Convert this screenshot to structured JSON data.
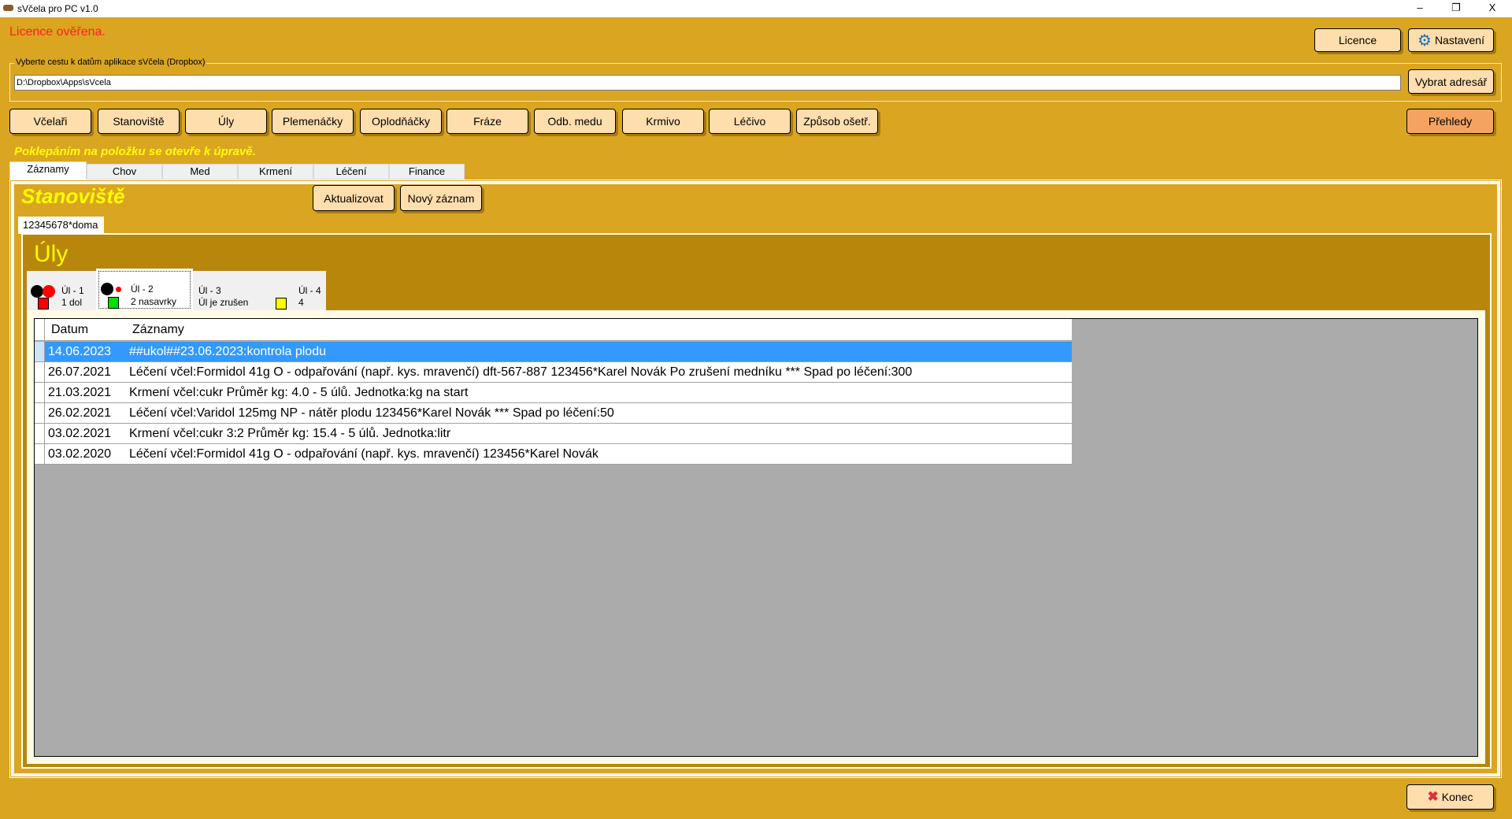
{
  "window": {
    "title": "sVčela pro PC v1.0",
    "minimize": "–",
    "restore": "❐",
    "close": "X"
  },
  "license_status": "Licence ověřena.",
  "top_buttons": {
    "licence": "Licence",
    "settings": "Nastavení"
  },
  "path": {
    "legend": "Vyberte cestu k datům aplikace sVčela (Dropbox)",
    "value": "D:\\Dropbox\\Apps\\sVcela",
    "browse": "Vybrat adresář"
  },
  "nav": [
    "Včelaři",
    "Stanoviště",
    "Úly",
    "Plemenáčky",
    "Oplodňáčky",
    "Fráze",
    "Odb. medu",
    "Krmivo",
    "Léčivo",
    "Způsob ošetř."
  ],
  "overview": "Přehledy",
  "hint": "Poklepáním na položku se otevře k úpravě.",
  "tabs": [
    "Záznamy",
    "Chov",
    "Med",
    "Krmení",
    "Léčení",
    "Finance"
  ],
  "section": {
    "title": "Stanoviště",
    "refresh": "Aktualizovat",
    "new": "Nový záznam",
    "site_tab": "12345678*doma",
    "hives_title": "Úly"
  },
  "hives": [
    {
      "name": "Úl - 1",
      "info": "1 dol",
      "square": "#ff0000"
    },
    {
      "name": "Úl - 2",
      "info": "2 nasavrky",
      "square": "#00e000"
    },
    {
      "name": "Úl - 3",
      "info": "Úl je zrušen"
    },
    {
      "name": "Úl - 4",
      "info": "4",
      "square": "#ffff00"
    }
  ],
  "grid": {
    "headers": [
      "Datum",
      "Záznamy"
    ],
    "rows": [
      {
        "date": "14.06.2023",
        "text": "##ukol##23.06.2023:kontrola plodu"
      },
      {
        "date": "26.07.2021",
        "text": "Léčení včel:Formidol 41g O - odpařování (např. kys. mravenčí) dft-567-887 123456*Karel Novák Po zrušení medníku *** Spad po léčení:300"
      },
      {
        "date": "21.03.2021",
        "text": "Krmení včel:cukr Průměr kg: 4.0 - 5 úlů. Jednotka:kg na start"
      },
      {
        "date": "26.02.2021",
        "text": "Léčení včel:Varidol 125mg NP - nátěr plodu  123456*Karel Novák *** Spad po léčení:50"
      },
      {
        "date": "03.02.2021",
        "text": "Krmení včel:cukr 3:2 Průměr kg: 15.4 - 5 úlů. Jednotka:litr"
      },
      {
        "date": "03.02.2020",
        "text": "Léčení včel:Formidol 41g O - odpařování (např. kys. mravenčí)  123456*Karel Novák"
      }
    ]
  },
  "exit": "Konec"
}
